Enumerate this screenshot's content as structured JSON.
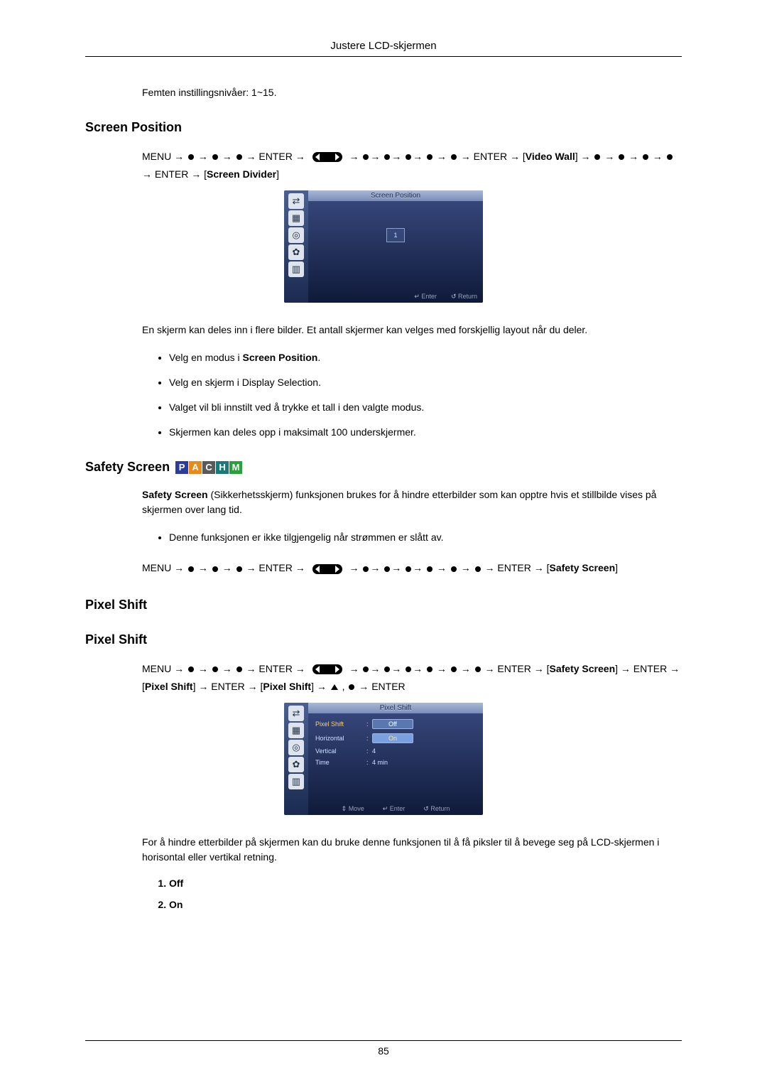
{
  "header_title": "Justere LCD-skjermen",
  "intro_line": "Femten instillingsnivåer: 1~15.",
  "section1_title": "Screen Position",
  "nav1": {
    "menu": "MENU",
    "enter": "ENTER",
    "videoWall": "Video Wall",
    "screenDivider": "Screen Divider"
  },
  "osd1": {
    "title": "Screen Position",
    "cell": "1",
    "footer_enter": "Enter",
    "footer_return": "Return"
  },
  "section1_para": "En skjerm kan deles inn i flere bilder. Et antall skjermer kan velges med forskjellig layout når du deler.",
  "section1_bullets": [
    {
      "pre": "Velg en modus i ",
      "bold": "Screen Position",
      "post": "."
    },
    {
      "pre": "Velg en skjerm i Display Selection.",
      "bold": "",
      "post": ""
    },
    {
      "pre": "Valget vil bli innstilt ved å trykke et tall i den valgte modus.",
      "bold": "",
      "post": ""
    },
    {
      "pre": "Skjermen kan deles opp i maksimalt 100 underskjermer.",
      "bold": "",
      "post": ""
    }
  ],
  "section2_title": "Safety Screen",
  "badges": [
    "P",
    "A",
    "C",
    "H",
    "M"
  ],
  "section2_para_pre_bold": "Safety Screen",
  "section2_para_rest": " (Sikkerhetsskjerm) funksjonen brukes for å hindre etterbilder som kan opptre hvis et stillbilde vises på skjermen over lang tid.",
  "section2_bullet": "Denne funksjonen er ikke tilgjengelig når strømmen er slått av.",
  "nav2": {
    "menu": "MENU",
    "enter": "ENTER",
    "safetyScreen": "Safety Screen"
  },
  "section3_title": "Pixel Shift",
  "section3b_title": "Pixel Shift",
  "nav3": {
    "menu": "MENU",
    "enter": "ENTER",
    "safetyScreen": "Safety Screen",
    "pixelShift": "Pixel Shift"
  },
  "osd2": {
    "title": "Pixel Shift",
    "rows": [
      {
        "label": "Pixel Shift",
        "off": "Off",
        "on": "On"
      },
      {
        "label": "Horizontal",
        "value": ""
      },
      {
        "label": "Vertical",
        "value": "4"
      },
      {
        "label": "Time",
        "value": "4 min"
      }
    ],
    "footer_move": "Move",
    "footer_enter": "Enter",
    "footer_return": "Return"
  },
  "section3_para": "For å hindre etterbilder på skjermen kan du bruke denne funksjonen til å få piksler til å bevege seg på LCD-skjermen i horisontal eller vertikal retning.",
  "section3_list": [
    "Off",
    "On"
  ],
  "page_number": "85"
}
